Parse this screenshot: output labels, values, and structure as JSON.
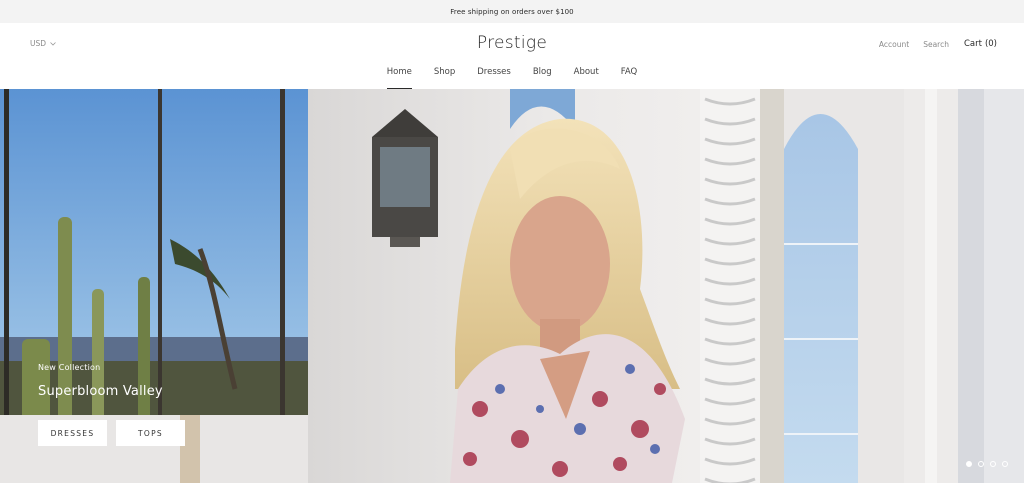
{
  "announcement": "Free shipping on orders over $100",
  "header": {
    "currency": "USD",
    "logo": "Prestige",
    "account": "Account",
    "search": "Search",
    "cart_label": "Cart",
    "cart_count": "(0)"
  },
  "nav": {
    "items": [
      {
        "label": "Home",
        "active": true
      },
      {
        "label": "Shop"
      },
      {
        "label": "Dresses"
      },
      {
        "label": "Blog"
      },
      {
        "label": "About"
      },
      {
        "label": "FAQ"
      }
    ]
  },
  "hero": {
    "subtitle": "New Collection",
    "title": "Superbloom Valley",
    "buttons": [
      "DRESSES",
      "TOPS"
    ],
    "slides": 4,
    "active_slide": 1
  },
  "colors": {
    "accent": "#1c1b1b",
    "announcement_bg": "#f3f3f3"
  }
}
